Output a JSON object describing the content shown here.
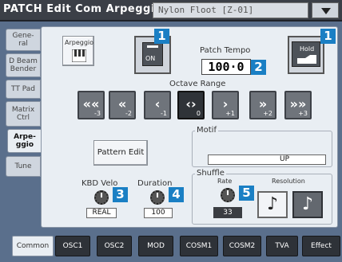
{
  "title": {
    "text": "PATCH Edit Com Arpeggio",
    "patch_name": "Nylon Floot  [Z-01]"
  },
  "left_tabs": [
    {
      "label": "Gene-\nral"
    },
    {
      "label": "D Beam\nBender"
    },
    {
      "label": "TT Pad"
    },
    {
      "label": "Matrix\nCtrl"
    },
    {
      "label": "Arpe-\nggio"
    },
    {
      "label": "Tune"
    }
  ],
  "arpeggio": {
    "label": "Arpeggio",
    "switch_value": "ON"
  },
  "patch_tempo": {
    "label": "Patch Tempo",
    "value": "100·0",
    "hold_label": "Hold"
  },
  "octave_range": {
    "label": "Octave Range",
    "buttons": [
      {
        "glyph": "««",
        "sub": "-3"
      },
      {
        "glyph": "«",
        "sub": "-2"
      },
      {
        "glyph": "‹",
        "sub": "-1"
      },
      {
        "glyph": "‹›",
        "sub": "0"
      },
      {
        "glyph": "›",
        "sub": "+1"
      },
      {
        "glyph": "»",
        "sub": "+2"
      },
      {
        "glyph": "»»",
        "sub": "+3"
      }
    ],
    "selected": "0"
  },
  "pattern_edit": {
    "label": "Pattern Edit"
  },
  "motif": {
    "label": "Motif",
    "value": "UP"
  },
  "kbd_velo": {
    "label": "KBD Velo",
    "value": "REAL"
  },
  "duration": {
    "label": "Duration",
    "value": "100"
  },
  "shuffle": {
    "label": "Shuffle",
    "rate_label": "Rate",
    "rate_value": "33",
    "resolution_label": "Resolution"
  },
  "callouts": [
    "1",
    "1",
    "2",
    "3",
    "4",
    "5"
  ],
  "bottom_tabs": [
    {
      "label": "Common"
    },
    {
      "label": "OSC1"
    },
    {
      "label": "OSC2"
    },
    {
      "label": "MOD"
    },
    {
      "label": "COSM1"
    },
    {
      "label": "COSM2"
    },
    {
      "label": "TVA"
    },
    {
      "label": "Effect"
    }
  ],
  "colors": {
    "callout": "#1a7fc4",
    "title_bar": "#3b3f47",
    "panel": "#e9eef3"
  }
}
